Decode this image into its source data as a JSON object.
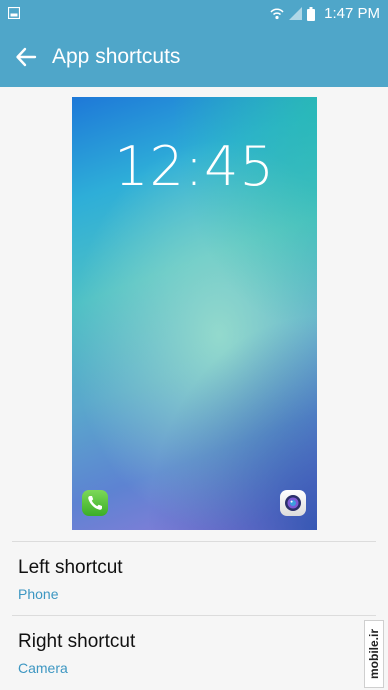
{
  "status_bar": {
    "time": "1:47 PM",
    "icons": [
      "gallery-icon",
      "wifi-icon",
      "signal-icon",
      "battery-icon"
    ]
  },
  "app_bar": {
    "title": "App shortcuts",
    "back_icon": "arrow-left-icon"
  },
  "preview": {
    "clock": "12:45",
    "left_icon": "phone-icon",
    "right_icon": "camera-icon"
  },
  "settings": [
    {
      "label": "Left shortcut",
      "value": "Phone"
    },
    {
      "label": "Right shortcut",
      "value": "Camera"
    }
  ],
  "watermark": {
    "text": "mobile.ir"
  },
  "colors": {
    "header": "#4fa6c9",
    "accent_text": "#3d97c2",
    "background": "#f6f6f6"
  }
}
